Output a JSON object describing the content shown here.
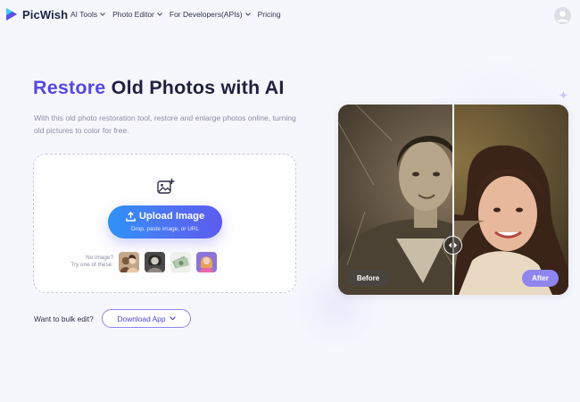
{
  "app": {
    "name": "PicWish"
  },
  "nav": [
    {
      "label": "AI Tools",
      "has_dropdown": true
    },
    {
      "label": "Photo Editor",
      "has_dropdown": true
    },
    {
      "label": "For Developers(APIs)",
      "has_dropdown": true
    },
    {
      "label": "Pricing",
      "has_dropdown": false
    }
  ],
  "hero": {
    "headline_accent": "Restore",
    "headline_rest": "Old Photos with AI",
    "subtitle": "With this old photo restoration tool, restore and enlarge photos online, turning old pictures to color for free."
  },
  "upload": {
    "button_label": "Upload Image",
    "button_sub": "Drop, paste image, or URL",
    "sample_hint_line1": "No image?",
    "sample_hint_line2": "Try one of these:",
    "samples": [
      "sample-couple-photo",
      "sample-woman-portrait",
      "sample-money-photo",
      "sample-girl-portrait"
    ]
  },
  "bulk": {
    "prompt": "Want to bulk edit?",
    "download_label": "Download App"
  },
  "compare": {
    "before_label": "Before",
    "after_label": "After",
    "slider_position": 0.5
  },
  "colors": {
    "accent": "#5448e0",
    "upload_gradient_start": "#2e93f7",
    "upload_gradient_end": "#5d5bef",
    "after_badge": "#8e85ee"
  },
  "icons": [
    "picwish-logo-icon",
    "chevron-down-icon",
    "user-avatar-icon",
    "add-image-icon",
    "upload-icon",
    "compare-handle-icon",
    "sparkle-icon"
  ]
}
